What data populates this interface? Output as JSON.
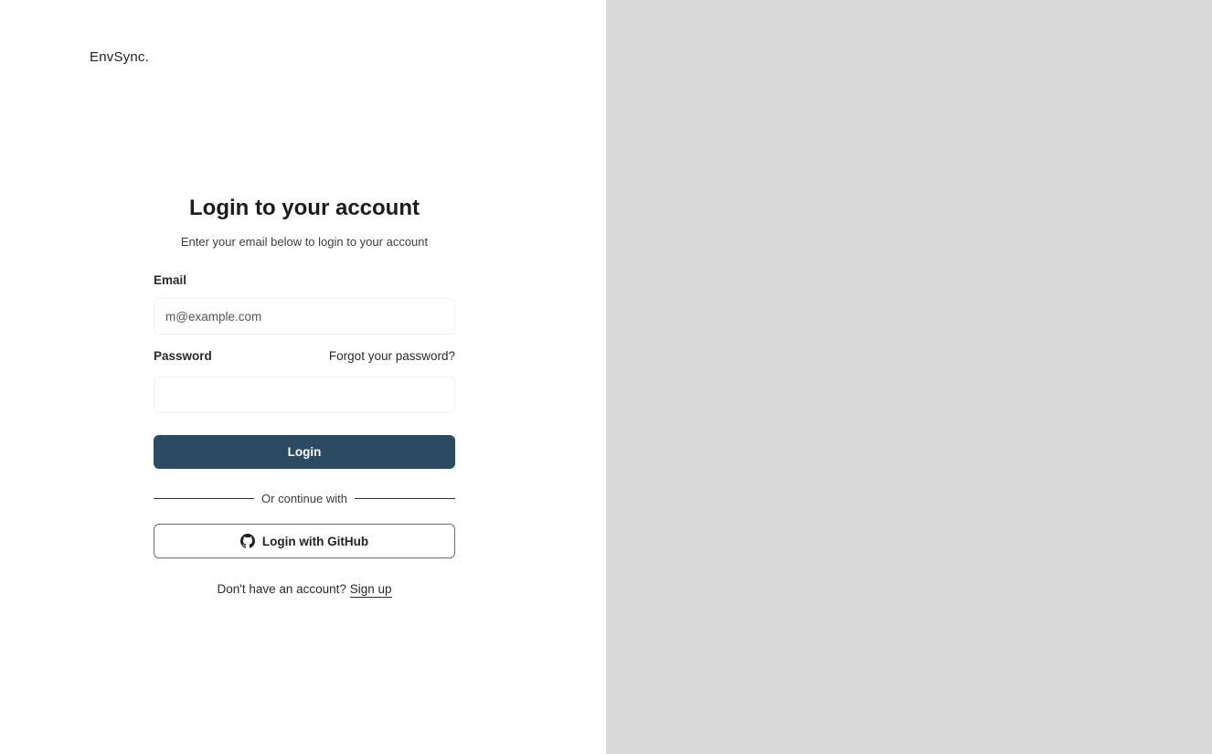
{
  "brand": {
    "name": "EnvSync."
  },
  "login": {
    "title": "Login to your account",
    "subtitle": "Enter your email below to login to your account",
    "email_label": "Email",
    "email_placeholder": "m@example.com",
    "password_label": "Password",
    "forgot_password": "Forgot your password?",
    "password_value": "",
    "login_button": "Login",
    "divider_text": "Or continue with",
    "github_button": "Login with GitHub",
    "signup_prompt": "Don't have an account?",
    "signup_link": "Sign up"
  },
  "icons": {
    "github": "github-icon"
  },
  "colors": {
    "primary_button": "#2d4a63",
    "right_panel": "#d9d9d9",
    "background": "#ffffff"
  }
}
